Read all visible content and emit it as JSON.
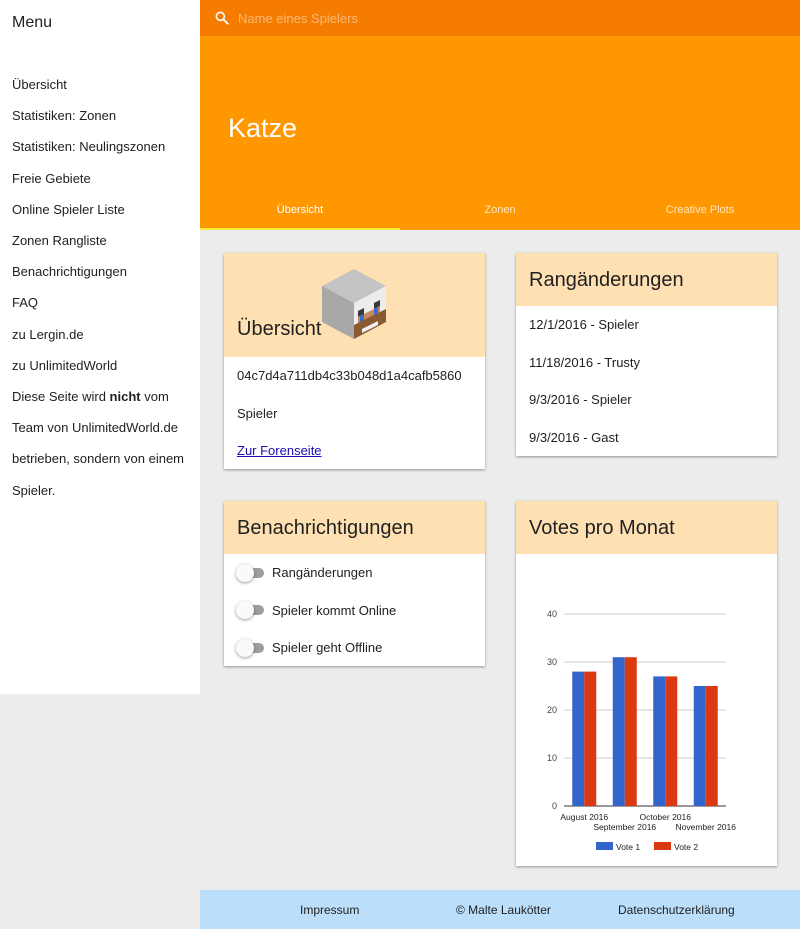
{
  "sidebar": {
    "title": "Menu",
    "items": [
      {
        "label": "Übersicht"
      },
      {
        "label": "Statistiken: Zonen"
      },
      {
        "label": "Statistiken: Neulingszonen"
      },
      {
        "label": "Freie Gebiete"
      },
      {
        "label": "Online Spieler Liste"
      },
      {
        "label": "Zonen Rangliste"
      },
      {
        "label": "Benachrichtigungen"
      },
      {
        "label": "FAQ"
      },
      {
        "label": "zu Lergin.de"
      },
      {
        "label": "zu UnlimitedWorld"
      }
    ],
    "note": {
      "before": "Diese Seite wird ",
      "bold": "nicht",
      "after": " vom Team von UnlimitedWorld.de betrieben, sondern von einem Spieler."
    }
  },
  "header": {
    "search_placeholder": "Name eines Spielers",
    "search_value": "",
    "player_name": "Katze",
    "tabs": [
      {
        "label": "Übersicht",
        "active": true
      },
      {
        "label": "Zonen",
        "active": false
      },
      {
        "label": "Creative Plots",
        "active": false
      }
    ]
  },
  "overview_card": {
    "title": "Übersicht",
    "uuid": "04c7d4a711db4c33b048d1a4cafb5860",
    "rank": "Spieler",
    "forum_link": "Zur Forenseite",
    "avatar_icon": "player-head-icon"
  },
  "rank_card": {
    "title": "Rangänderungen",
    "entries": [
      {
        "text": "12/1/2016 - Spieler"
      },
      {
        "text": "11/18/2016 - Trusty"
      },
      {
        "text": "9/3/2016 - Spieler"
      },
      {
        "text": "9/3/2016 - Gast"
      }
    ]
  },
  "notify_card": {
    "title": "Benachrichtigungen",
    "toggles": [
      {
        "label": "Rangänderungen",
        "on": false
      },
      {
        "label": "Spieler kommt Online",
        "on": false
      },
      {
        "label": "Spieler geht Offline",
        "on": false
      }
    ]
  },
  "votes_card": {
    "title": "Votes pro Monat"
  },
  "chart_data": {
    "type": "bar",
    "categories": [
      "August 2016",
      "September 2016",
      "October 2016",
      "November 2016"
    ],
    "series": [
      {
        "name": "Vote 1",
        "values": [
          28,
          31,
          27,
          25
        ],
        "color": "#3366cc"
      },
      {
        "name": "Vote 2",
        "values": [
          28,
          31,
          27,
          25
        ],
        "color": "#dc3912"
      }
    ],
    "ylim": [
      0,
      40
    ],
    "yticks": [
      0,
      10,
      20,
      30,
      40
    ],
    "grid": true,
    "legend": "bottom"
  },
  "footer": {
    "impressum": "Impressum",
    "copyright": "© Malte Laukötter",
    "privacy": "Datenschutzerklärung"
  },
  "colors": {
    "topbar": "#f57c00",
    "hero": "#ff9800",
    "card_header": "#ffe0b2",
    "footer": "#bbdefb",
    "tab_indicator": "#ffeb3b"
  }
}
